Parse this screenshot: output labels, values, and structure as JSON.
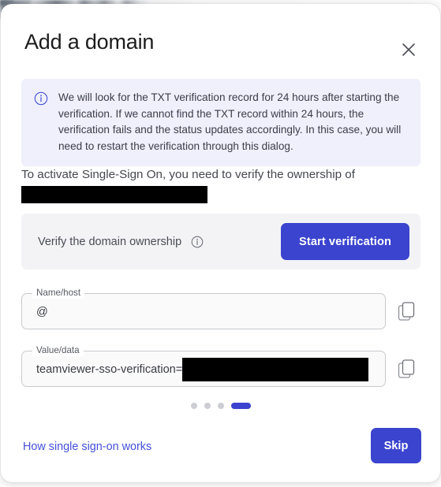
{
  "dialog": {
    "title": "Add a domain",
    "close_label": "Close",
    "close_icon": "close-icon"
  },
  "info_banner": {
    "icon": "info-circle-icon",
    "text": "We will look for the TXT verification record for 24 hours after starting the verification. If we cannot find the TXT record within 24 hours, the verification fails and the status updates accordingly. In this case, you will need to restart the verification through this dialog.",
    "background_color": "#eff0fb",
    "icon_color": "#4550d8"
  },
  "activation": {
    "text": "To activate Single-Sign On, you need to verify the ownership of",
    "domain_redacted": true
  },
  "verify_section": {
    "label": "Verify the domain ownership",
    "info_icon": "info-circle-icon",
    "button_label": "Start verification",
    "button_color": "#3a44ce",
    "panel_color": "#f3f3f6"
  },
  "fields": [
    {
      "name": "name-host",
      "legend": "Name/host",
      "value": "@",
      "redacted": false,
      "copy_icon": "copy-icon",
      "copy_label": "Copy"
    },
    {
      "name": "value-data",
      "legend": "Value/data",
      "value": "teamviewer-sso-verification=",
      "redacted": true,
      "copy_icon": "copy-icon",
      "copy_label": "Copy"
    }
  ],
  "stepper": {
    "total": 4,
    "active_index": 3,
    "active_color": "#3a44ce",
    "inactive_color": "#cdced3"
  },
  "footer": {
    "link_label": "How single sign-on works",
    "link_color": "#4550d8",
    "skip_label": "Skip",
    "skip_color": "#3a44ce"
  }
}
